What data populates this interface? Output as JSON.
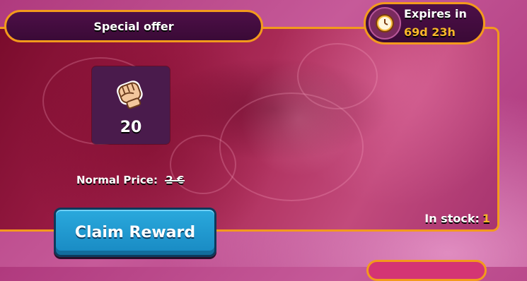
{
  "offer": {
    "title": "Special offer",
    "expires_label": "Expires in",
    "expires_time": "69d 23h"
  },
  "item": {
    "icon": "fist-icon",
    "count": "20"
  },
  "price": {
    "label": "Normal Price:",
    "value": "2 €"
  },
  "stock": {
    "label": "In stock:",
    "value": "1"
  },
  "actions": {
    "claim_label": "Claim Reward"
  },
  "colors": {
    "border": "#f39a1c",
    "accent_text": "#f8b62a",
    "button": "#1f96cf",
    "pill": "#3f0c3b"
  }
}
